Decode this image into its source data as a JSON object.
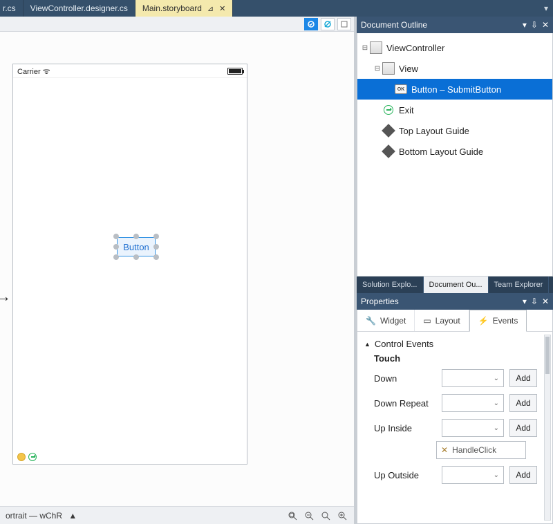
{
  "tabs": {
    "partial": "r.cs",
    "inactive": "ViewController.designer.cs",
    "active": "Main.storyboard"
  },
  "canvas": {
    "carrier": "Carrier",
    "selected_button": "Button"
  },
  "statusbar": {
    "text": "ortrait — wChR"
  },
  "outline": {
    "title": "Document Outline",
    "items": {
      "root": "ViewController",
      "view": "View",
      "selected": "Button  –  SubmitButton",
      "exit": "Exit",
      "top_guide": "Top Layout Guide",
      "bottom_guide": "Bottom Layout Guide"
    }
  },
  "tabwell": {
    "solution": "Solution Explo...",
    "document": "Document Ou...",
    "team": "Team Explorer"
  },
  "properties": {
    "title": "Properties",
    "tabs": {
      "widget": "Widget",
      "layout": "Layout",
      "events": "Events"
    },
    "section": "Control Events",
    "subhead": "Touch",
    "events": {
      "down": "Down",
      "down_repeat": "Down Repeat",
      "up_inside": "Up Inside",
      "up_outside": "Up Outside"
    },
    "add": "Add",
    "handler": "HandleClick"
  }
}
